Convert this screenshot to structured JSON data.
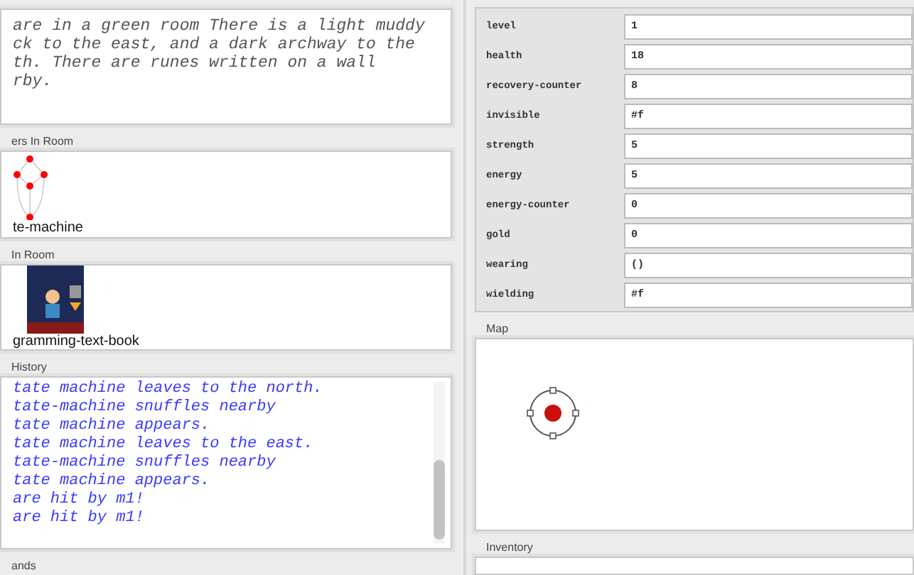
{
  "description": {
    "lines": [
      "are in a green room There is a light muddy",
      "ck to the east, and a dark archway to the",
      "th. There are runes written on a wall",
      "rby."
    ]
  },
  "characters": {
    "label": "ers In Room",
    "items": [
      {
        "name": "te-machine"
      }
    ]
  },
  "items": {
    "label": "In Room",
    "items": [
      {
        "name": "gramming-text-book"
      }
    ]
  },
  "history": {
    "label": "History",
    "lines": [
      "tate machine leaves to the north.",
      "tate-machine snuffles nearby",
      "tate machine appears.",
      "tate machine leaves to the east.",
      "tate-machine snuffles nearby",
      "tate machine appears.",
      "are hit by m1!",
      "are hit by m1!"
    ]
  },
  "commands": {
    "label": "ands"
  },
  "stats": [
    {
      "name": "level",
      "value": "1"
    },
    {
      "name": "health",
      "value": "18"
    },
    {
      "name": "recovery-counter",
      "value": "8"
    },
    {
      "name": "invisible",
      "value": "#f"
    },
    {
      "name": "strength",
      "value": "5"
    },
    {
      "name": "energy",
      "value": "5"
    },
    {
      "name": "energy-counter",
      "value": "0"
    },
    {
      "name": "gold",
      "value": "0"
    },
    {
      "name": "wearing",
      "value": "()"
    },
    {
      "name": "wielding",
      "value": "#f"
    }
  ],
  "map": {
    "label": "Map"
  },
  "inventory": {
    "label": "Inventory"
  }
}
